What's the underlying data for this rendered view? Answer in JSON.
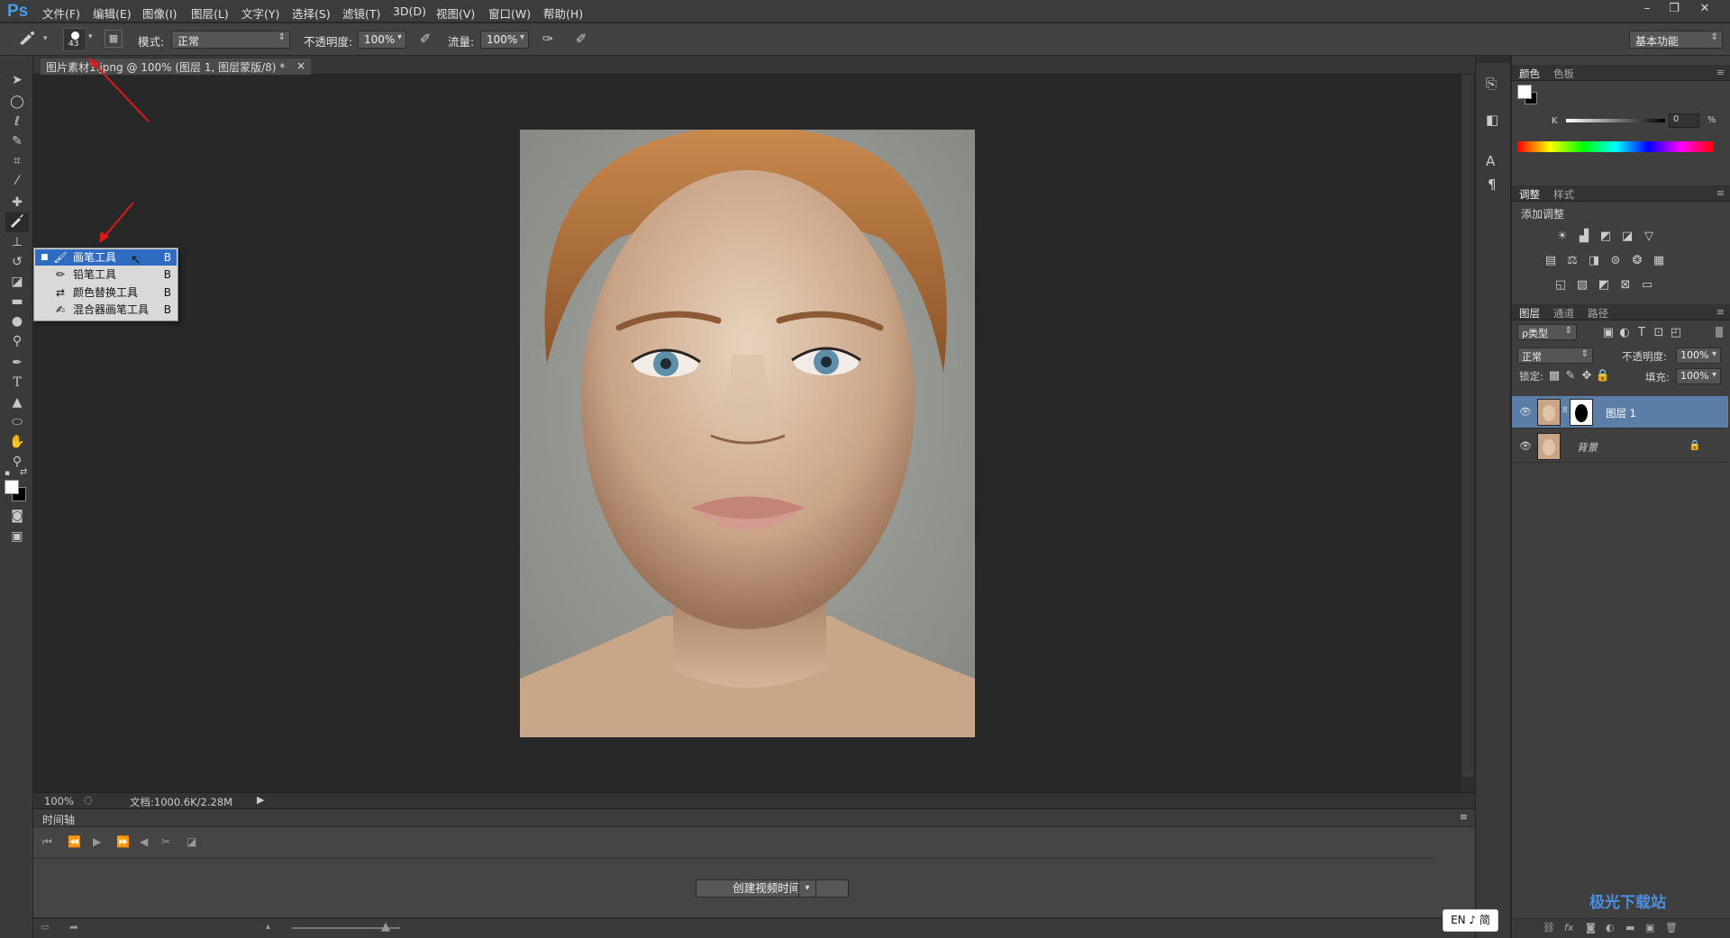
{
  "app": {
    "logo": "Ps"
  },
  "menu": [
    "文件(F)",
    "编辑(E)",
    "图像(I)",
    "图层(L)",
    "文字(Y)",
    "选择(S)",
    "滤镜(T)",
    "3D(D)",
    "视图(V)",
    "窗口(W)",
    "帮助(H)"
  ],
  "window_controls": {
    "minimize": "–",
    "restore": "❐",
    "close": "✕"
  },
  "options": {
    "brush_size": "43",
    "mode_label": "模式:",
    "mode_value": "正常",
    "opacity_label": "不透明度:",
    "opacity_value": "100%",
    "flow_label": "流量:",
    "flow_value": "100%",
    "workspace": "基本功能"
  },
  "document": {
    "tab_title": "图片素材1.jpng @ 100% (图层 1, 图层蒙版/8) *",
    "close": "×",
    "zoom": "100%",
    "doc_size": "文档:1000.6K/2.28M"
  },
  "tool_popup": {
    "items": [
      {
        "label": "画笔工具",
        "key": "B",
        "selected": true
      },
      {
        "label": "铅笔工具",
        "key": "B",
        "selected": false
      },
      {
        "label": "颜色替换工具",
        "key": "B",
        "selected": false
      },
      {
        "label": "混合器画笔工具",
        "key": "B",
        "selected": false
      }
    ]
  },
  "timeline": {
    "title": "时间轴",
    "create_button": "创建视频时间轴"
  },
  "color_panel": {
    "tabs": [
      "颜色",
      "色板"
    ],
    "channel_label": "K",
    "channel_value": "0",
    "unit": "%"
  },
  "adjust_panel": {
    "tabs": [
      "调整",
      "样式"
    ],
    "title": "添加调整"
  },
  "layers_panel": {
    "tabs": [
      "图层",
      "通道",
      "路径"
    ],
    "filter": "ρ类型",
    "blend_mode": "正常",
    "opacity_label": "不透明度:",
    "opacity_value": "100%",
    "lock_label": "锁定:",
    "fill_label": "填充:",
    "fill_value": "100%",
    "layers": [
      {
        "name": "图层 1",
        "selected": true
      },
      {
        "name": "背景",
        "selected": false
      }
    ]
  },
  "ime": "EN ♪ 简",
  "watermark": "极光下载站",
  "colors": {
    "accent": "#2f6cc1",
    "annotation_arrow": "#e01818",
    "selected_layer": "#5a7ea8"
  }
}
